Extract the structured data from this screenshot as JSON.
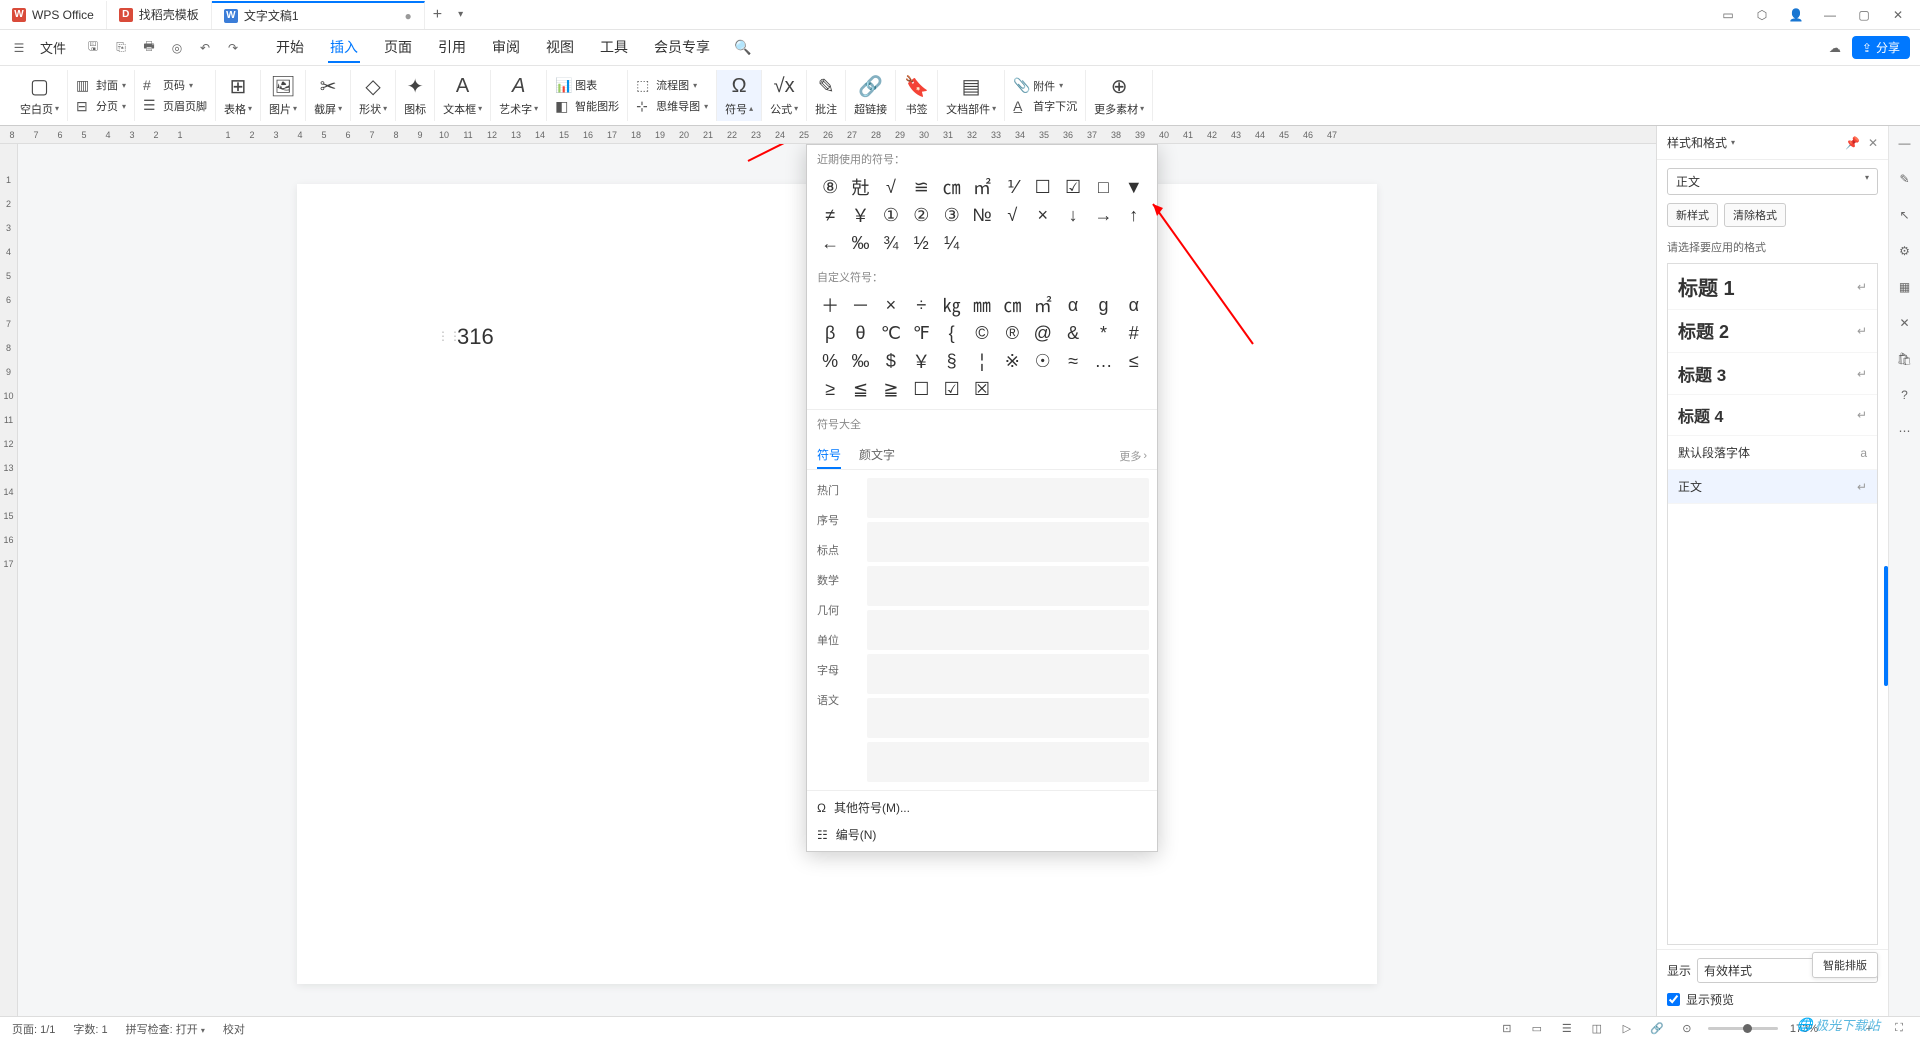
{
  "titlebar": {
    "app_name": "WPS Office",
    "tabs": [
      {
        "icon": "D",
        "label": "找稻壳模板"
      },
      {
        "icon": "W",
        "label": "文字文稿1"
      }
    ]
  },
  "menubar": {
    "file": "文件",
    "tabs": [
      "开始",
      "插入",
      "页面",
      "引用",
      "审阅",
      "视图",
      "工具",
      "会员专享"
    ],
    "active_tab": "插入",
    "share": "分享"
  },
  "ribbon": {
    "blank_page": "空白页",
    "cover": "封面",
    "pagination": "分页",
    "page_num": "页码",
    "header_footer": "页眉页脚",
    "table": "表格",
    "picture": "图片",
    "screenshot": "截屏",
    "shape": "形状",
    "icon": "图标",
    "textbox": "文本框",
    "wordart": "艺术字",
    "chart": "图表",
    "flowchart": "流程图",
    "smartart": "智能图形",
    "mindmap": "思维导图",
    "symbol": "符号",
    "formula": "公式",
    "comment": "批注",
    "hyperlink": "超链接",
    "bookmark": "书签",
    "doc_parts": "文档部件",
    "attachment": "附件",
    "dropcap": "首字下沉",
    "more": "更多素材"
  },
  "ruler": {
    "h": [
      "8",
      "7",
      "6",
      "5",
      "4",
      "3",
      "2",
      "1",
      "",
      "1",
      "2",
      "3",
      "4",
      "5",
      "6",
      "7",
      "8",
      "9",
      "10",
      "11",
      "12",
      "13",
      "14",
      "15",
      "16",
      "17",
      "18",
      "19",
      "20",
      "21",
      "22",
      "23",
      "24",
      "25",
      "26",
      "27",
      "28",
      "29",
      "30",
      "31",
      "32",
      "33",
      "34",
      "35",
      "36",
      "37",
      "38",
      "39",
      "40",
      "41",
      "42",
      "43",
      "44",
      "45",
      "46",
      "47"
    ],
    "v": [
      "",
      "1",
      "2",
      "3",
      "4",
      "5",
      "6",
      "7",
      "8",
      "9",
      "10",
      "11",
      "12",
      "13",
      "14",
      "15",
      "16",
      "17"
    ]
  },
  "page": {
    "content": "316"
  },
  "symbol_panel": {
    "recent_title": "近期使用的符号：",
    "recent": [
      "⑧",
      "兙",
      "√",
      "≌",
      "㎝",
      "㎡",
      "⅟",
      "☐",
      "☑",
      "□",
      "▼",
      "≠",
      "￥",
      "①",
      "②",
      "③",
      "№",
      "√",
      "×",
      "↓",
      "→",
      "↑",
      "←",
      "‰",
      "¾",
      "½",
      "¼"
    ],
    "custom_title": "自定义符号：",
    "custom": [
      "＋",
      "－",
      "×",
      "÷",
      "㎏",
      "㎜",
      "㎝",
      "㎡",
      "α",
      "ɡ",
      "α",
      "β",
      "θ",
      "℃",
      "℉",
      "{",
      "©",
      "®",
      "@",
      "&",
      "*",
      "#",
      "%",
      "‰",
      "$",
      "￥",
      "§",
      "¦",
      "※",
      "☉",
      "≈",
      "…",
      "≤",
      "≥",
      "≦",
      "≧",
      "☐",
      "☑",
      "☒"
    ],
    "all_title": "符号大全",
    "tab_symbol": "符号",
    "tab_emoji": "颜文字",
    "more": "更多",
    "categories": [
      "热门",
      "序号",
      "标点",
      "数学",
      "几何",
      "单位",
      "字母",
      "语文"
    ],
    "other_symbols": "其他符号(M)...",
    "numbering": "编号(N)"
  },
  "sidebar": {
    "title": "样式和格式",
    "current_style": "正文",
    "new_style": "新样式",
    "clear_format": "清除格式",
    "select_label": "请选择要应用的格式",
    "styles": [
      {
        "name": "标题 1",
        "class": "h1"
      },
      {
        "name": "标题 2",
        "class": "h2"
      },
      {
        "name": "标题 3",
        "class": "h3"
      },
      {
        "name": "标题 4",
        "class": "h4"
      },
      {
        "name": "默认段落字体",
        "class": "normal"
      },
      {
        "name": "正文",
        "class": "normal"
      }
    ],
    "selected_style": "正文",
    "display_label": "显示",
    "display_value": "有效样式",
    "preview_label": "显示预览",
    "smart_layout": "智能排版"
  },
  "statusbar": {
    "page": "页面: 1/1",
    "words": "字数: 1",
    "spellcheck": "拼写检查: 打开",
    "proofread": "校对",
    "zoom": "173%"
  },
  "watermark": "极光下载站"
}
